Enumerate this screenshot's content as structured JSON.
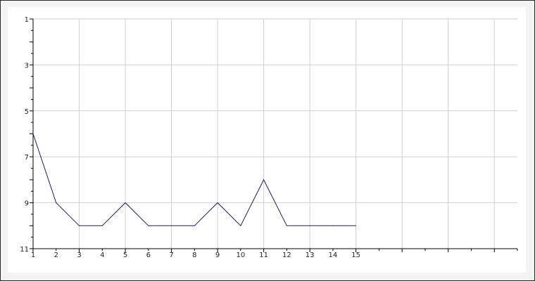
{
  "chart_data": {
    "type": "line",
    "title": "",
    "xlabel": "",
    "ylabel": "",
    "xlim": [
      1,
      22
    ],
    "ylim": [
      11,
      1
    ],
    "y_inverted": true,
    "grid": true,
    "x_tick_labels": [
      1,
      2,
      3,
      4,
      5,
      6,
      7,
      8,
      9,
      10,
      11,
      12,
      13,
      14,
      15
    ],
    "y_tick_labels": [
      1,
      3,
      5,
      7,
      9,
      11
    ],
    "series": [
      {
        "color": "#1a1a6e",
        "x": [
          1,
          2,
          3,
          4,
          5,
          6,
          7,
          8,
          9,
          10,
          11,
          12,
          13,
          14,
          15
        ],
        "y": [
          6,
          9,
          10,
          10,
          9,
          10,
          10,
          10,
          9,
          10,
          8,
          10,
          10,
          10,
          10
        ]
      }
    ]
  }
}
